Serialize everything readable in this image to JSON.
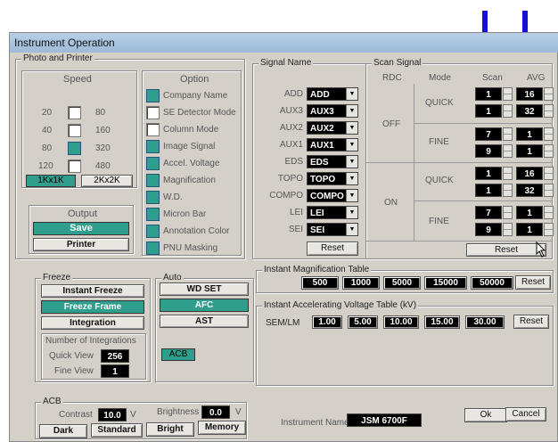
{
  "window": {
    "title": "Instrument Operation"
  },
  "photo_printer": {
    "title": "Photo and Printer",
    "speed": {
      "title": "Speed",
      "rows": [
        {
          "left": "20",
          "right": "80",
          "checked": false
        },
        {
          "left": "40",
          "right": "160",
          "checked": false
        },
        {
          "left": "80",
          "right": "320",
          "checked": true
        },
        {
          "left": "120",
          "right": "480",
          "checked": false
        }
      ],
      "res1": "1Kx1K",
      "res2": "2Kx2K"
    },
    "option": {
      "title": "Option",
      "items": [
        {
          "label": "Company Name",
          "checked": true
        },
        {
          "label": "SE Detector Mode",
          "checked": false
        },
        {
          "label": "Column Mode",
          "checked": false
        },
        {
          "label": "Image Signal",
          "checked": true
        },
        {
          "label": "Accel. Voltage",
          "checked": true
        },
        {
          "label": "Magnification",
          "checked": true
        },
        {
          "label": "W.D.",
          "checked": true
        },
        {
          "label": "Micron Bar",
          "checked": true
        },
        {
          "label": "Annotation Color",
          "checked": true
        },
        {
          "label": "PNU Masking",
          "checked": true
        }
      ]
    },
    "output": {
      "title": "Output",
      "save": "Save",
      "printer": "Printer"
    }
  },
  "signal_name": {
    "title": "Signal Name",
    "rows": [
      {
        "label": "ADD",
        "value": "ADD"
      },
      {
        "label": "AUX3",
        "value": "AUX3"
      },
      {
        "label": "AUX2",
        "value": "AUX2"
      },
      {
        "label": "AUX1",
        "value": "AUX1"
      },
      {
        "label": "EDS",
        "value": "EDS"
      },
      {
        "label": "TOPO",
        "value": "TOPO"
      },
      {
        "label": "COMPO",
        "value": "COMPO"
      },
      {
        "label": "LEI",
        "value": "LEI"
      },
      {
        "label": "SEI",
        "value": "SEI"
      }
    ],
    "reset": "Reset"
  },
  "scan_signal": {
    "title": "Scan Signal",
    "headers": {
      "rdc": "RDC",
      "mode": "Mode",
      "scan": "Scan",
      "avg": "AVG"
    },
    "off": "OFF",
    "on": "ON",
    "quick": "QUICK",
    "fine": "FINE",
    "values": [
      {
        "scan": "1",
        "avg": "16"
      },
      {
        "scan": "1",
        "avg": "32"
      },
      {
        "scan": "7",
        "avg": "1"
      },
      {
        "scan": "9",
        "avg": "1"
      },
      {
        "scan": "1",
        "avg": "16"
      },
      {
        "scan": "1",
        "avg": "32"
      },
      {
        "scan": "7",
        "avg": "1"
      },
      {
        "scan": "9",
        "avg": "1"
      }
    ],
    "reset": "Reset"
  },
  "freeze": {
    "title": "Freeze",
    "instant": "Instant Freeze",
    "frame": "Freeze Frame",
    "integration": "Integration",
    "num_title": "Number of Integrations",
    "quick_label": "Quick View",
    "quick_value": "256",
    "fine_label": "Fine View",
    "fine_value": "1"
  },
  "auto": {
    "title": "Auto",
    "wd": "WD SET",
    "afc": "AFC",
    "ast": "AST",
    "acb": "ACB"
  },
  "mag_table": {
    "title": "Instant Magnification Table",
    "values": [
      "500",
      "1000",
      "5000",
      "15000",
      "50000"
    ],
    "reset": "Reset"
  },
  "volt_table": {
    "title": "Instant Accelerating Voltage Table (kV)",
    "label": "SEM/LM",
    "values": [
      "1.00",
      "5.00",
      "10.00",
      "15.00",
      "30.00"
    ],
    "reset": "Reset"
  },
  "acb": {
    "title": "ACB",
    "contrast_label": "Contrast",
    "contrast_value": "10.0",
    "contrast_unit": "V",
    "brightness_label": "Brightness",
    "brightness_value": "0.0",
    "brightness_unit": "V",
    "dark": "Dark",
    "standard": "Standard",
    "bright": "Bright",
    "memory": "Memory"
  },
  "footer": {
    "instrument_label": "Instrument Name",
    "instrument_value": "JSM 6700F",
    "ok": "Ok",
    "cancel": "Cancel"
  },
  "colors": {
    "accent": "#2f9e8c",
    "annotation_arrow": "#1410d8"
  }
}
